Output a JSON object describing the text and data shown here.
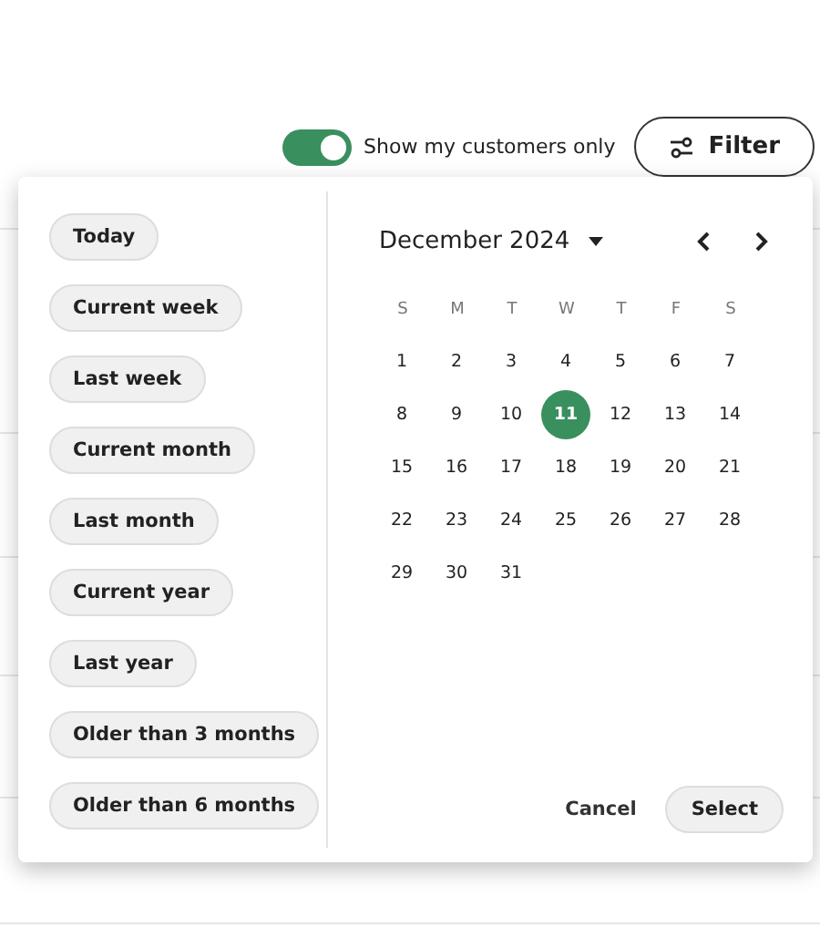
{
  "toolbar": {
    "toggle": {
      "label": "Show my customers only",
      "on": true
    },
    "filter_button": {
      "label": "Filter"
    }
  },
  "date_picker": {
    "presets": [
      "Today",
      "Current week",
      "Last week",
      "Current month",
      "Last month",
      "Current year",
      "Last year",
      "Older than 3 months",
      "Older than 6 months"
    ],
    "calendar": {
      "month_label": "December 2024",
      "weekdays": [
        "S",
        "M",
        "T",
        "W",
        "T",
        "F",
        "S"
      ],
      "days": [
        {
          "label": "1",
          "selected": false
        },
        {
          "label": "2",
          "selected": false
        },
        {
          "label": "3",
          "selected": false
        },
        {
          "label": "4",
          "selected": false
        },
        {
          "label": "5",
          "selected": false
        },
        {
          "label": "6",
          "selected": false
        },
        {
          "label": "7",
          "selected": false
        },
        {
          "label": "8",
          "selected": false
        },
        {
          "label": "9",
          "selected": false
        },
        {
          "label": "10",
          "selected": false
        },
        {
          "label": "11",
          "selected": true
        },
        {
          "label": "12",
          "selected": false
        },
        {
          "label": "13",
          "selected": false
        },
        {
          "label": "14",
          "selected": false
        },
        {
          "label": "15",
          "selected": false
        },
        {
          "label": "16",
          "selected": false
        },
        {
          "label": "17",
          "selected": false
        },
        {
          "label": "18",
          "selected": false
        },
        {
          "label": "19",
          "selected": false
        },
        {
          "label": "20",
          "selected": false
        },
        {
          "label": "21",
          "selected": false
        },
        {
          "label": "22",
          "selected": false
        },
        {
          "label": "23",
          "selected": false
        },
        {
          "label": "24",
          "selected": false
        },
        {
          "label": "25",
          "selected": false
        },
        {
          "label": "26",
          "selected": false
        },
        {
          "label": "27",
          "selected": false
        },
        {
          "label": "28",
          "selected": false
        },
        {
          "label": "29",
          "selected": false
        },
        {
          "label": "30",
          "selected": false
        },
        {
          "label": "31",
          "selected": false
        }
      ]
    },
    "actions": {
      "cancel": "Cancel",
      "select": "Select"
    }
  }
}
